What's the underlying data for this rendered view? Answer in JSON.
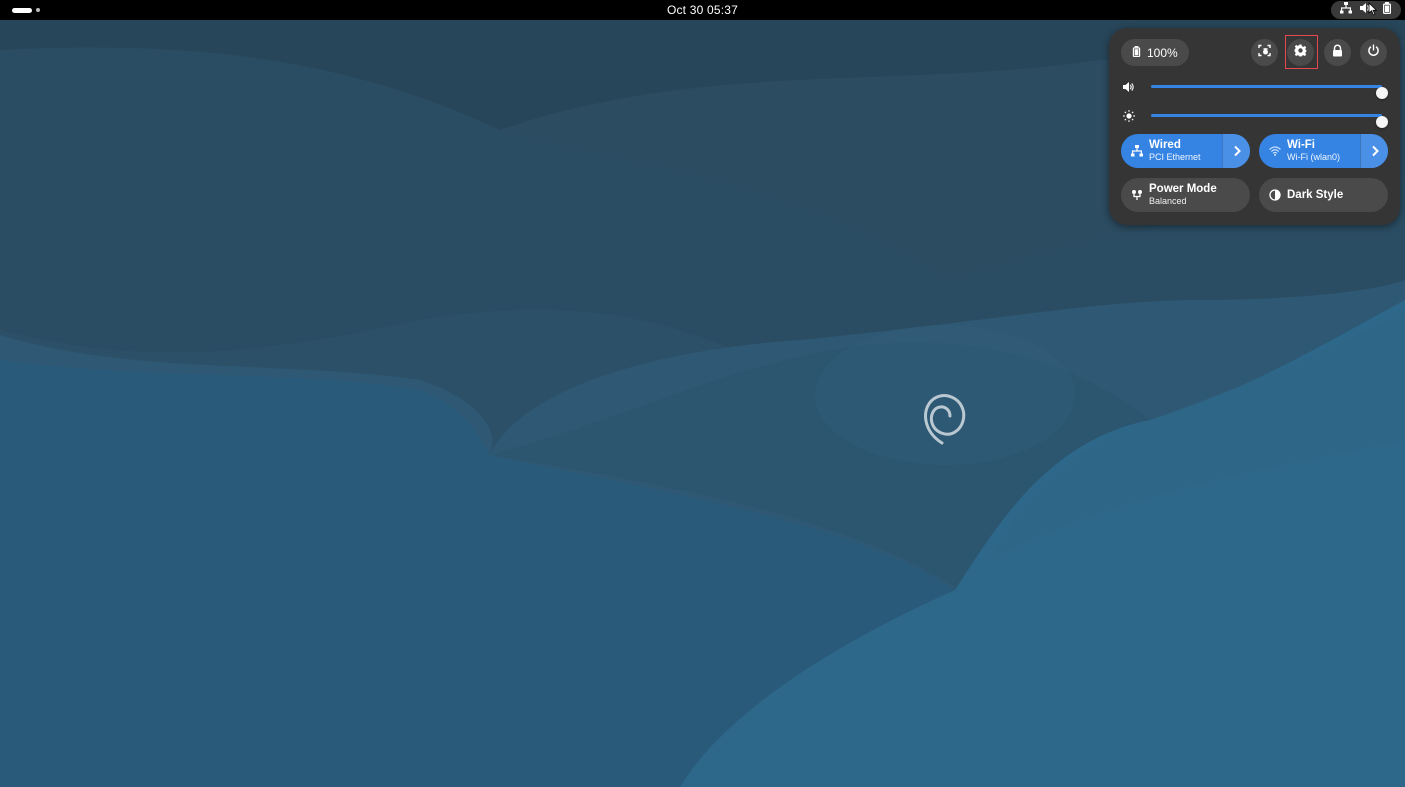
{
  "topbar": {
    "clock": "Oct 30  05:37",
    "tray_icons": [
      "network-wired-icon",
      "volume-icon",
      "battery-icon"
    ]
  },
  "quick_settings": {
    "battery_label": "100%",
    "header_buttons": [
      "screenshot-icon",
      "settings-icon",
      "lock-icon",
      "power-icon"
    ],
    "volume": {
      "level": 1.0,
      "icon": "volume-icon"
    },
    "brightness": {
      "level": 1.0,
      "icon": "brightness-icon"
    },
    "toggles": {
      "wired": {
        "title": "Wired",
        "subtitle": "PCI Ethernet",
        "active": true
      },
      "wifi": {
        "title": "Wi-Fi",
        "subtitle": "Wi-Fi (wlan0)",
        "active": true
      },
      "power_mode": {
        "title": "Power Mode",
        "subtitle": "Balanced",
        "active": false
      },
      "dark_style": {
        "title": "Dark Style",
        "active": false
      }
    }
  },
  "colors": {
    "accent": "#3584e4",
    "panel": "#353535",
    "button": "#4a4a4a",
    "focus": "#e5484d"
  }
}
